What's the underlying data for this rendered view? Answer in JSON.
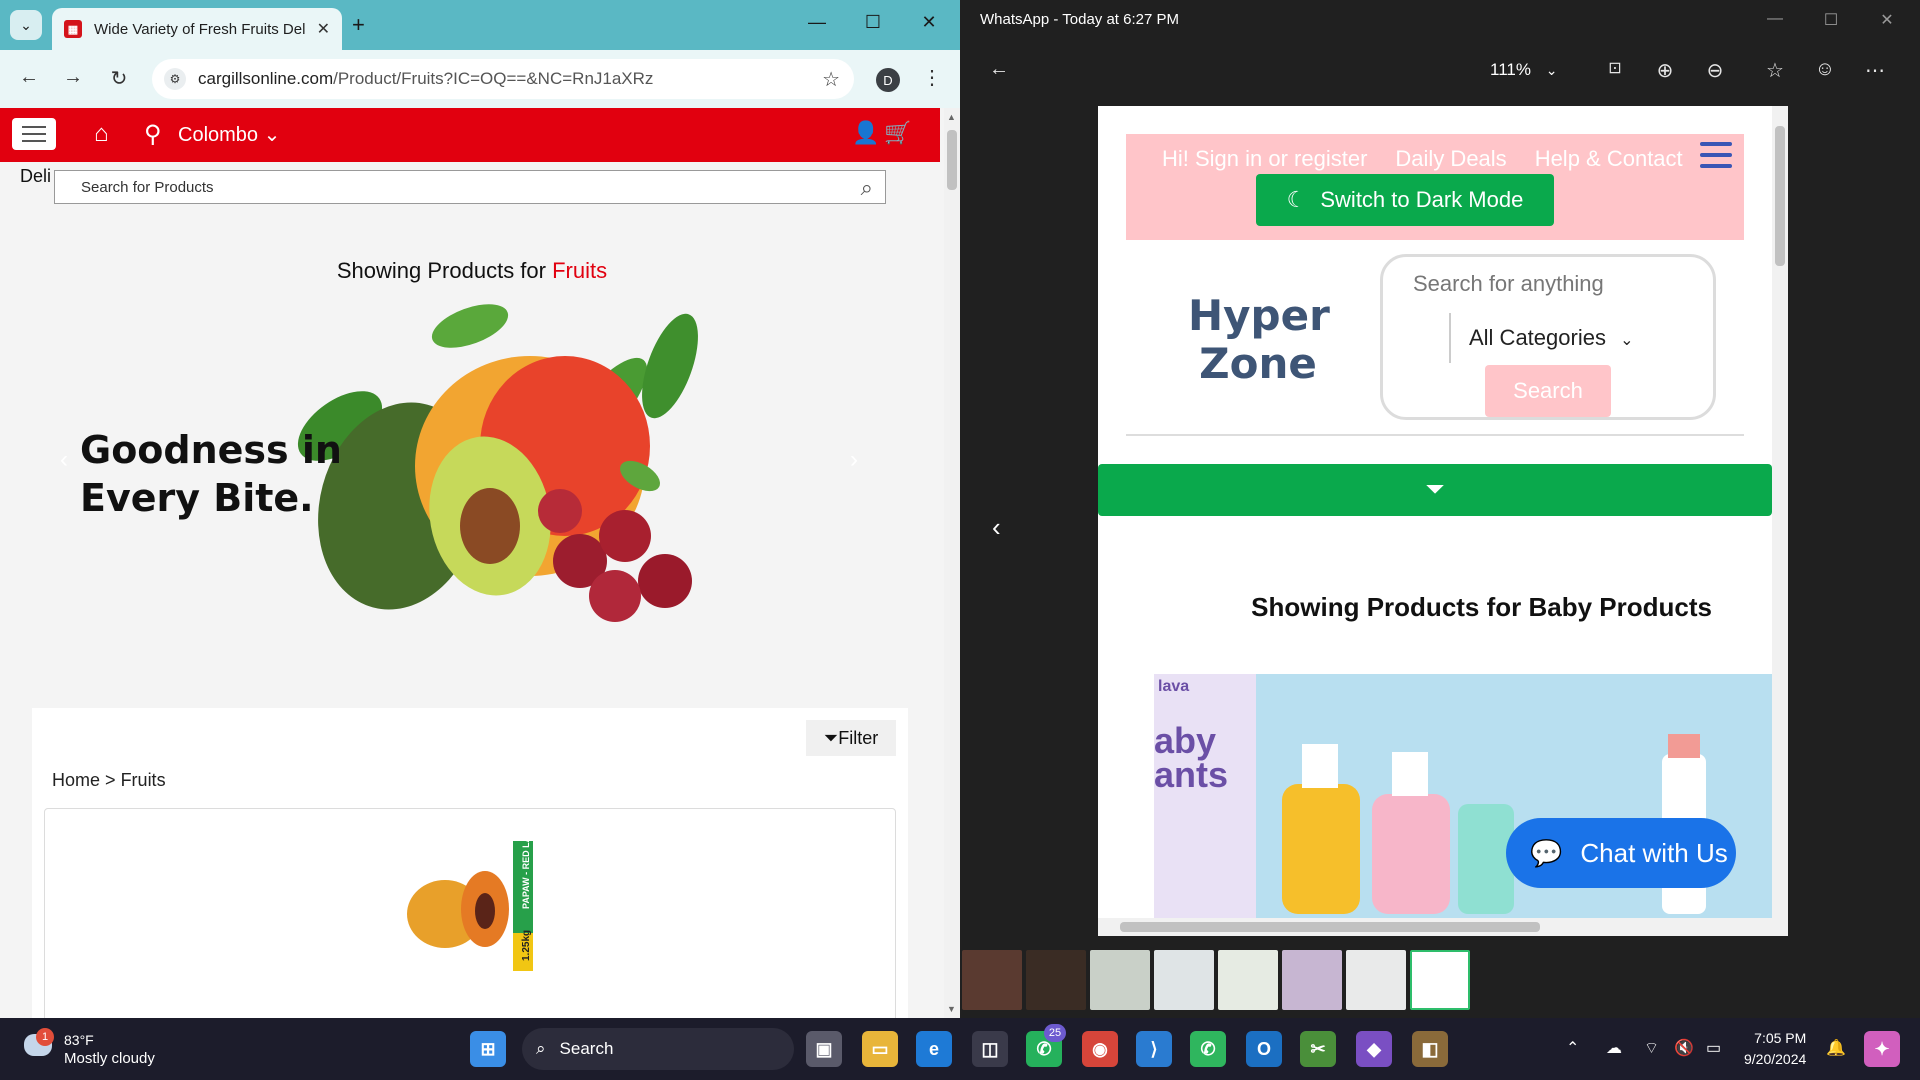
{
  "chrome": {
    "tab_title": "Wide Variety of Fresh Fruits Del",
    "new_tab": "+",
    "url_domain": "cargillsonline.com",
    "url_path": "/Product/Fruits?IC=OQ==&NC=RnJ1aXRz",
    "profile_letter": "D"
  },
  "site": {
    "city": "Colombo",
    "deliver_fragment": "Deli",
    "search_placeholder": "Search for Products",
    "showing_prefix": "Showing Products for ",
    "showing_category": "Fruits",
    "hero_line1": "Goodness in",
    "hero_line2": "Every Bite.",
    "filter_label": "Filter",
    "breadcrumb_home": "Home",
    "breadcrumb_sep": ">",
    "breadcrumb_current": "Fruits",
    "product_tag_name": "PAPAW - RED LADY",
    "product_tag_weight": "1.25kg"
  },
  "viewer": {
    "title": "WhatsApp - Today at 6:27 PM",
    "zoom": "111%"
  },
  "screenshot_page": {
    "nav_links": [
      "Hi! Sign in or register",
      "Daily Deals",
      "Help & Contact"
    ],
    "dark_mode_button": "Switch to Dark Mode",
    "brand_line1": "Hyper",
    "brand_line2": "Zone",
    "search_placeholder": "Search for anything",
    "category_select": "All Categories",
    "search_button": "Search",
    "showing_title": "Showing Products for Baby Products",
    "banner_text": "aby\nants",
    "banner_brand": "lava",
    "chat_button": "Chat with Us"
  },
  "taskbar": {
    "weather_temp": "83°F",
    "weather_desc": "Mostly cloudy",
    "weather_badge": "1",
    "search_label": "Search",
    "whatsapp_count": "25",
    "time": "7:05 PM",
    "date": "9/20/2024"
  },
  "colors": {
    "cargills_red": "#e1000f",
    "chrome_tab_strip": "#5ab8c4",
    "hyperzone_green": "#0aa94c",
    "hyperzone_pink": "#ffc5c9",
    "chat_blue": "#1a73e8"
  }
}
